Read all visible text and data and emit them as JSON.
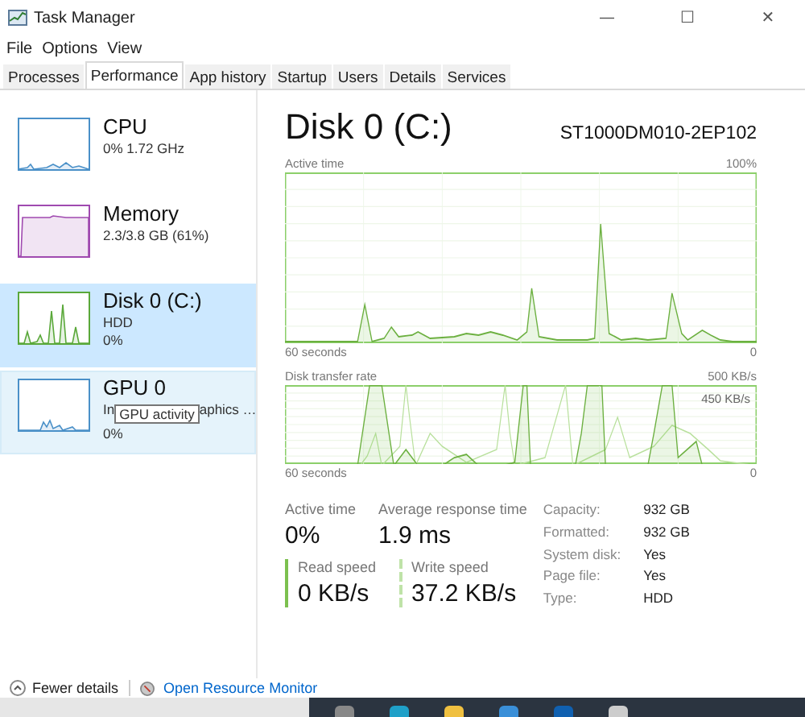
{
  "window": {
    "title": "Task Manager",
    "controls": [
      "—",
      "☐",
      "✕"
    ]
  },
  "menu": [
    "File",
    "Options",
    "View"
  ],
  "tabs": [
    {
      "label": "Processes",
      "selected": false
    },
    {
      "label": "Performance",
      "selected": true
    },
    {
      "label": "App history",
      "selected": false
    },
    {
      "label": "Startup",
      "selected": false
    },
    {
      "label": "Users",
      "selected": false
    },
    {
      "label": "Details",
      "selected": false
    },
    {
      "label": "Services",
      "selected": false
    }
  ],
  "sidebar": {
    "items": [
      {
        "kind": "cpu",
        "name": "CPU",
        "lines": [
          "0%  1.72 GHz"
        ],
        "color": "#4a90c8",
        "selected": false,
        "hovered": false
      },
      {
        "kind": "memory",
        "name": "Memory",
        "lines": [
          "2.3/3.8 GB (61%)"
        ],
        "color": "#a04ab0",
        "selected": false,
        "hovered": false
      },
      {
        "kind": "disk",
        "name": "Disk 0 (C:)",
        "lines": [
          "HDD",
          "0%"
        ],
        "color": "#5aa83a",
        "selected": true,
        "hovered": false
      },
      {
        "kind": "gpu",
        "name": "GPU 0",
        "line_start": "In",
        "line_end": "aphics …",
        "tooltip": "GPU activity",
        "lines": [
          "0%"
        ],
        "color": "#4a90c8",
        "selected": false,
        "hovered": true
      }
    ]
  },
  "main": {
    "title": "Disk 0 (C:)",
    "model": "ST1000DM010-2EP102",
    "charts": [
      {
        "kind": "active",
        "label": "Active time",
        "max": "100%",
        "time": "60 seconds",
        "min": "0"
      },
      {
        "kind": "transfer",
        "label": "Disk transfer rate",
        "max": "500 KB/s",
        "inner": "450 KB/s",
        "time": "60 seconds",
        "min": "0"
      }
    ],
    "stats": [
      {
        "label": "Active time",
        "value": "0%"
      },
      {
        "label": "Average response time",
        "value": "1.9 ms"
      }
    ],
    "speeds": [
      {
        "kind": "read",
        "label": "Read speed",
        "value": "0 KB/s"
      },
      {
        "kind": "write",
        "label": "Write speed",
        "value": "37.2 KB/s"
      }
    ],
    "properties": [
      {
        "label": "Capacity:",
        "value": "932 GB"
      },
      {
        "label": "Formatted:",
        "value": "932 GB"
      },
      {
        "label": "System disk:",
        "value": "Yes"
      },
      {
        "label": "Page file:",
        "value": "Yes"
      },
      {
        "label": "Type:",
        "value": "HDD"
      }
    ]
  },
  "footer": {
    "fewer": "Fewer details",
    "link": "Open Resource Monitor"
  }
}
